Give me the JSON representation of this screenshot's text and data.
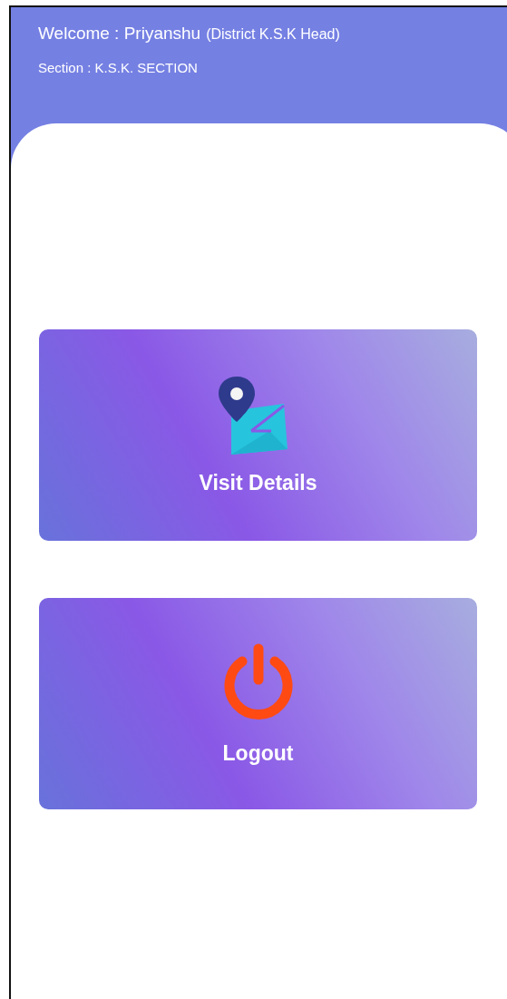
{
  "header": {
    "welcome": "Welcome : Priyanshu",
    "role": "(District K.S.K Head)",
    "section": "Section : K.S.K. SECTION"
  },
  "menu": [
    {
      "kind": "visit",
      "label": "Visit Details"
    },
    {
      "kind": "logout",
      "label": "Logout"
    }
  ]
}
